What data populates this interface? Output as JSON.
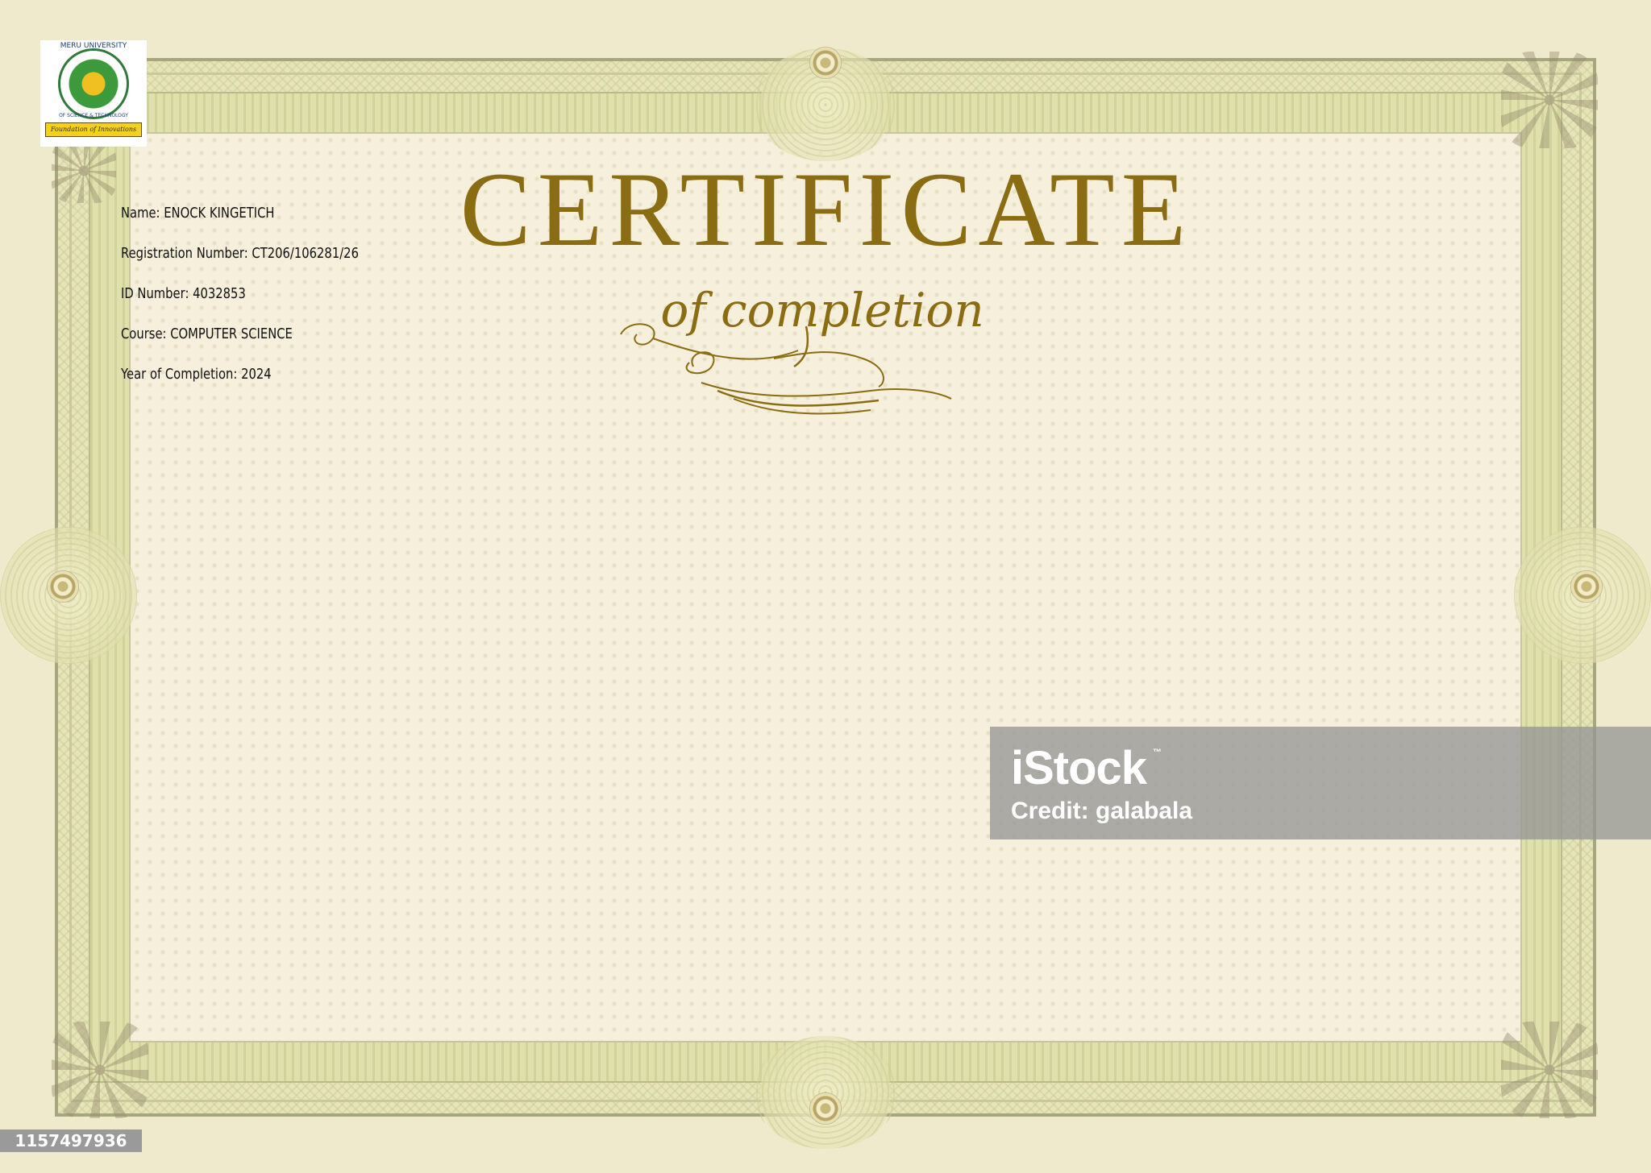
{
  "logo": {
    "ring_text": "MERU UNIVERSITY",
    "bottom_text": "OF SCIENCE & TECHNOLOGY",
    "banner_text": "Foundation of Innovations"
  },
  "details": {
    "name": "Name: ENOCK KINGETICH",
    "registration": "Registration Number: CT206/106281/26",
    "id_number": "ID Number: 4032853",
    "course": "Course: COMPUTER SCIENCE",
    "year": "Year of Completion: 2024"
  },
  "certificate": {
    "title": "CERTIFICATE",
    "subtitle": "of completion"
  },
  "watermark": {
    "brand": "iStock",
    "tm": "™",
    "credit": "Credit: galabala"
  },
  "stock_id": "1157497936",
  "colors": {
    "title_gold": "#8a6c12",
    "paper": "#f5efdb",
    "border_green": "#dfe0ab"
  }
}
